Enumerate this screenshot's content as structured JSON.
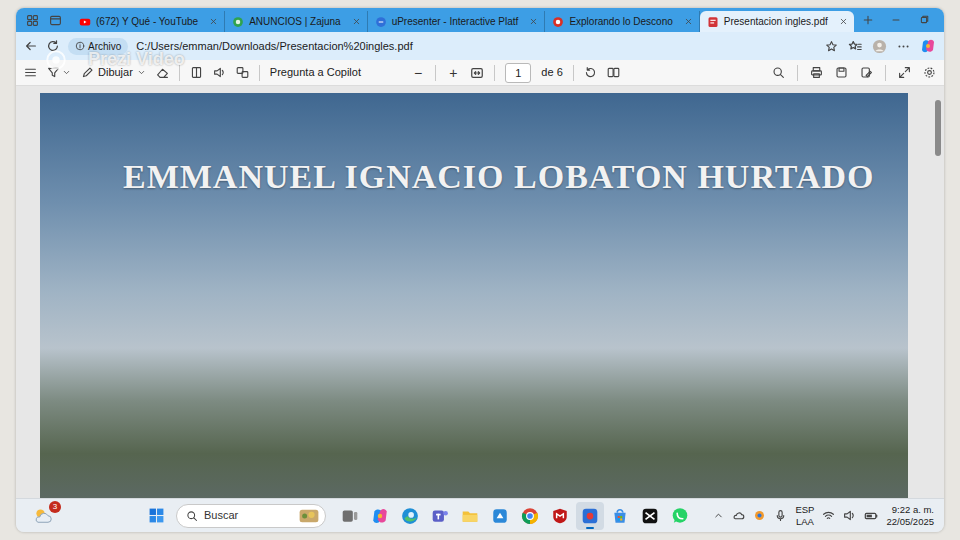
{
  "tabs": [
    {
      "label": "(672) Y Qué - YouTube",
      "selected": false,
      "kind": "youtube"
    },
    {
      "label": "ANUNCIOS | Zajuna",
      "selected": false,
      "kind": "zajuna"
    },
    {
      "label": "uPresenter - Interactive Platf",
      "selected": false,
      "kind": "upresenter"
    },
    {
      "label": "Explorando lo Descono",
      "selected": false,
      "kind": "record"
    },
    {
      "label": "Presentacion ingles.pdf",
      "selected": true,
      "kind": "pdf"
    }
  ],
  "address": {
    "scheme": "Archivo",
    "url": "C:/Users/emman/Downloads/Presentacion%20ingles.pdf"
  },
  "watermark": "Prezi Video",
  "toolbar": {
    "draw": "Dibujar",
    "copilot": "Pregunta a Copilot",
    "zoom_out": "−",
    "zoom_in": "+",
    "page": "1",
    "page_count": "de 6"
  },
  "document": {
    "title": "EMMANUEL IGNACIO LOBATON HURTADO"
  },
  "taskbar": {
    "weather_badge": "3",
    "search": "Buscar",
    "apps": [
      {
        "kind": "taskview",
        "selected": false
      },
      {
        "kind": "copilot",
        "selected": false
      },
      {
        "kind": "edge",
        "selected": false
      },
      {
        "kind": "teams",
        "selected": false
      },
      {
        "kind": "explorer",
        "selected": false
      },
      {
        "kind": "app",
        "selected": false
      },
      {
        "kind": "chrome",
        "selected": false
      },
      {
        "kind": "mcafee",
        "selected": false
      },
      {
        "kind": "recorder",
        "selected": true
      },
      {
        "kind": "store",
        "selected": false
      },
      {
        "kind": "capcut",
        "selected": false
      },
      {
        "kind": "whatsapp",
        "selected": false
      }
    ],
    "language": "ESP",
    "layout": "LAA",
    "time": "9:22 a. m.",
    "date": "22/05/2025"
  }
}
